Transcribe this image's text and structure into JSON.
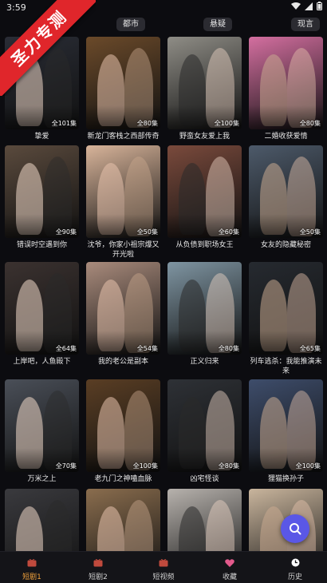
{
  "status": {
    "time": "3:59"
  },
  "ribbon": {
    "text": "圣力专测"
  },
  "top_tabs": [
    {
      "label": "都市"
    },
    {
      "label": "悬疑"
    },
    {
      "label": "现言"
    }
  ],
  "dramas": [
    {
      "title": "挚爱",
      "episodes": "全101集",
      "bg": "#2a2d36"
    },
    {
      "title": "新龙门客栈之西部传奇",
      "episodes": "全80集",
      "bg": "#6b4a2a"
    },
    {
      "title": "野蛮女友爱上我",
      "episodes": "全100集",
      "bg": "#8f8d86"
    },
    {
      "title": "二婚收获爱情",
      "episodes": "全80集",
      "bg": "#d46fa0"
    },
    {
      "title": "错误时空遇到你",
      "episodes": "全90集",
      "bg": "#5a4a3d"
    },
    {
      "title": "沈爷，你家小祖宗爆又开光啦",
      "episodes": "全50集",
      "bg": "#d8b49a"
    },
    {
      "title": "从负债到职场女王",
      "episodes": "全60集",
      "bg": "#7a4a3c"
    },
    {
      "title": "女友的隐藏秘密",
      "episodes": "全50集",
      "bg": "#4d5a6a"
    },
    {
      "title": "上岸吧，人鱼殿下",
      "episodes": "全64集",
      "bg": "#3b3230"
    },
    {
      "title": "我的老公是副本",
      "episodes": "全54集",
      "bg": "#a98b7c"
    },
    {
      "title": "正义归来",
      "episodes": "全80集",
      "bg": "#7f95a2"
    },
    {
      "title": "列车逃杀：我能推演未来",
      "episodes": "全65集",
      "bg": "#262a30"
    },
    {
      "title": "万米之上",
      "episodes": "全70集",
      "bg": "#4a4f58"
    },
    {
      "title": "老九门之神嗑血脉",
      "episodes": "全100集",
      "bg": "#5a3e24"
    },
    {
      "title": "凶宅怪谈",
      "episodes": "全80集",
      "bg": "#2e3136"
    },
    {
      "title": "狸猫换孙子",
      "episodes": "全100集",
      "bg": "#3e4d6b"
    },
    {
      "title": "",
      "episodes": "",
      "bg": "#3a3a3e"
    },
    {
      "title": "",
      "episodes": "",
      "bg": "#8a6d4e"
    },
    {
      "title": "",
      "episodes": "",
      "bg": "#b7b2ad"
    },
    {
      "title": "",
      "episodes": "",
      "bg": "#c9b59d"
    }
  ],
  "nav": [
    {
      "label": "短剧1",
      "icon": "tv-icon",
      "active": true
    },
    {
      "label": "短剧2",
      "icon": "tv-icon",
      "active": false
    },
    {
      "label": "短视频",
      "icon": "tv-icon",
      "active": false
    },
    {
      "label": "收藏",
      "icon": "heart-icon",
      "active": false
    },
    {
      "label": "历史",
      "icon": "clock-icon",
      "active": false
    }
  ],
  "colors": {
    "accent": "#f1a13c",
    "fab": "#5a57e6",
    "ribbon": "#e0262b"
  }
}
